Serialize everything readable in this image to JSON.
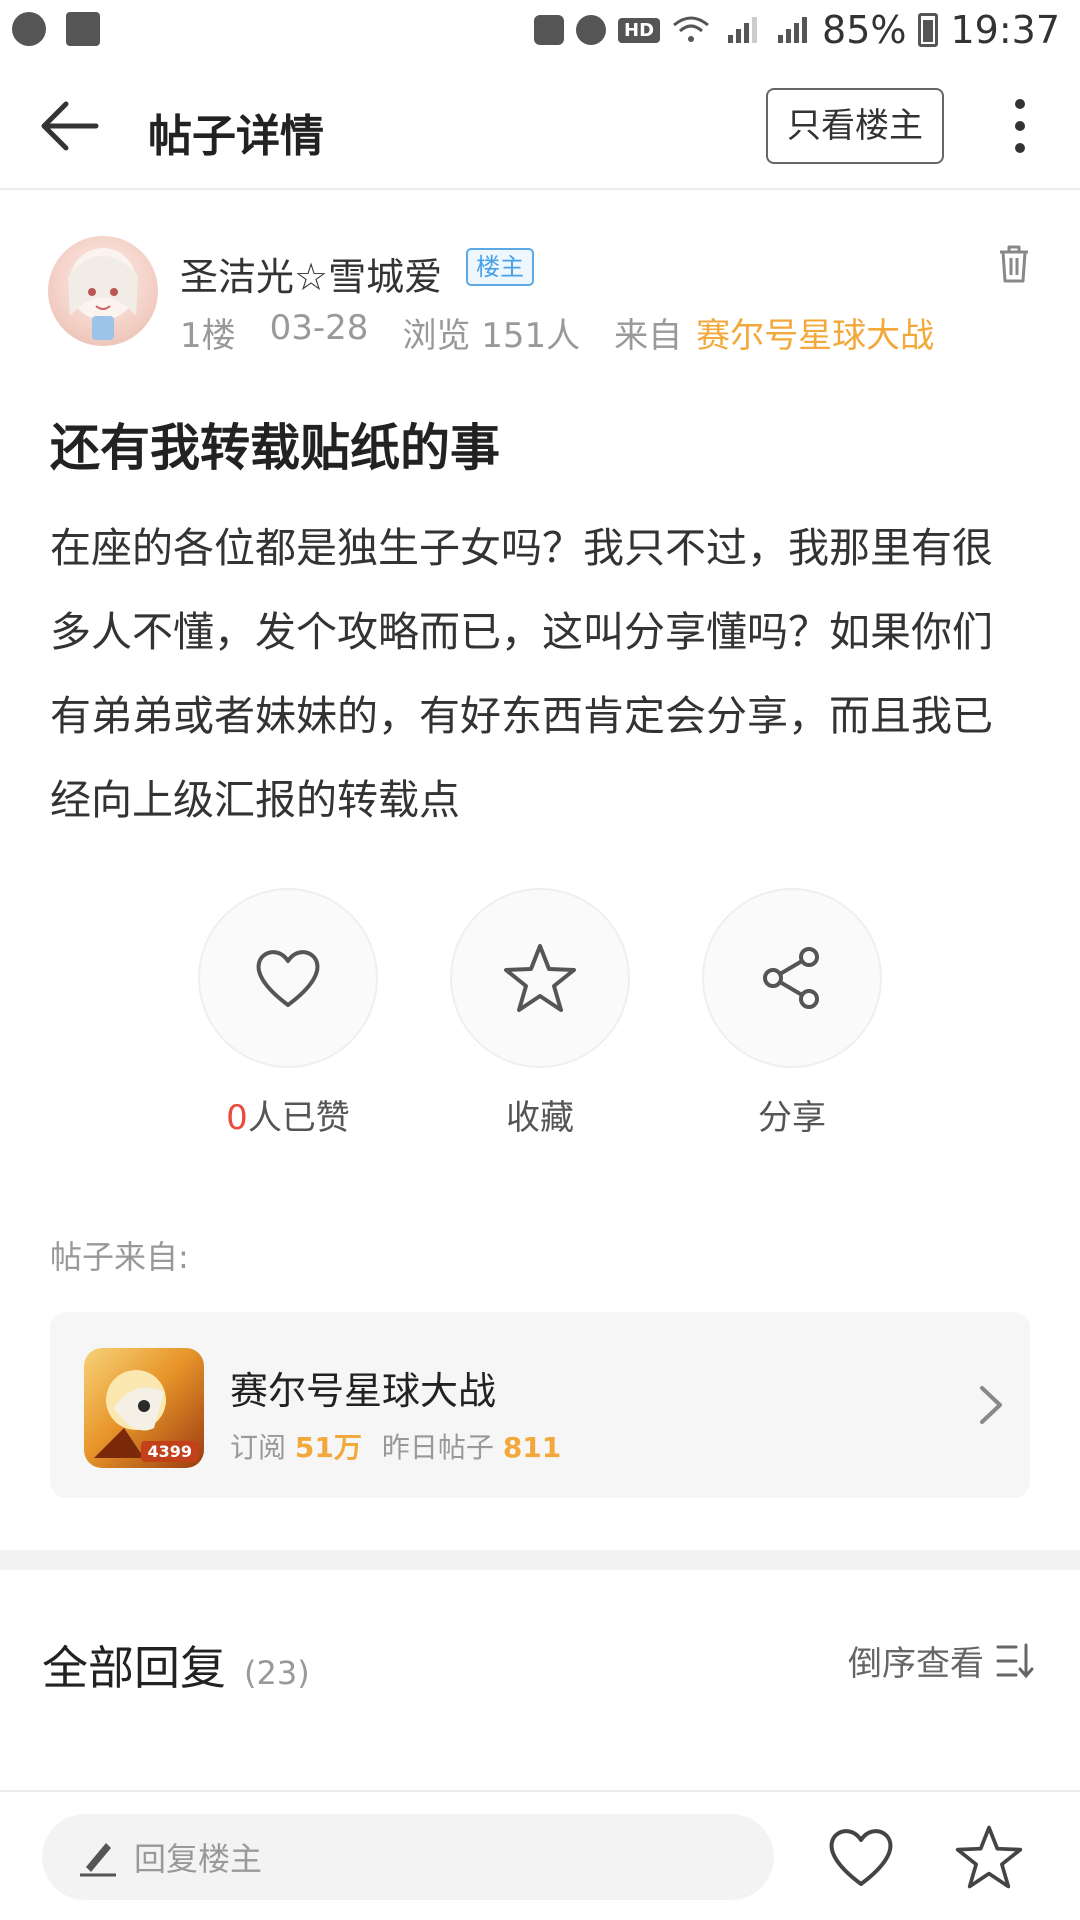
{
  "status_bar": {
    "battery": "85%",
    "time": "19:37",
    "hd": "HD"
  },
  "header": {
    "title": "帖子详情",
    "only_host_label": "只看楼主"
  },
  "author": {
    "name": "圣洁光☆雪城爱",
    "badge": "楼主",
    "floor": "1楼",
    "date": "03-28",
    "views": "浏览 151人",
    "from_prefix": "来自",
    "from_forum": "赛尔号星球大战"
  },
  "post": {
    "title": "还有我转载贴纸的事",
    "body": "在座的各位都是独生子女吗？我只不过，我那里有很多人不懂，发个攻略而已，这叫分享懂吗？如果你们有弟弟或者妹妹的，有好东西肯定会分享，而且我已经向上级汇报的转载点"
  },
  "actions": {
    "like_count": "0",
    "like_suffix": "人已赞",
    "collect": "收藏",
    "share": "分享"
  },
  "forum": {
    "from_label": "帖子来自:",
    "name": "赛尔号星球大战",
    "subscribe_label": "订阅",
    "subscribe_count": "51万",
    "yesterday_label": "昨日帖子",
    "yesterday_count": "811",
    "icon_tag": "4399"
  },
  "replies": {
    "title": "全部回复",
    "count": "(23)",
    "sort_label": "倒序查看"
  },
  "bottom_bar": {
    "reply_placeholder": "回复楼主"
  },
  "colors": {
    "accent_orange": "#f2a83b",
    "badge_blue": "#4aa0e8",
    "like_red": "#e94b3c"
  }
}
